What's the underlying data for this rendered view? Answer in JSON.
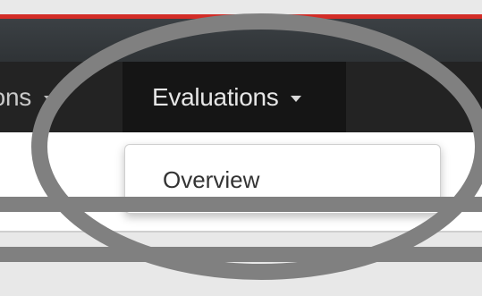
{
  "nav": {
    "prev_item_label": "ations",
    "active_item_label": "Evaluations"
  },
  "dropdown": {
    "items": [
      {
        "label": "Overview"
      }
    ]
  },
  "colors": {
    "accent_red": "#d32d27",
    "nav_background": "#232323",
    "nav_active_background": "#151515",
    "annotation_grey": "#808080"
  }
}
